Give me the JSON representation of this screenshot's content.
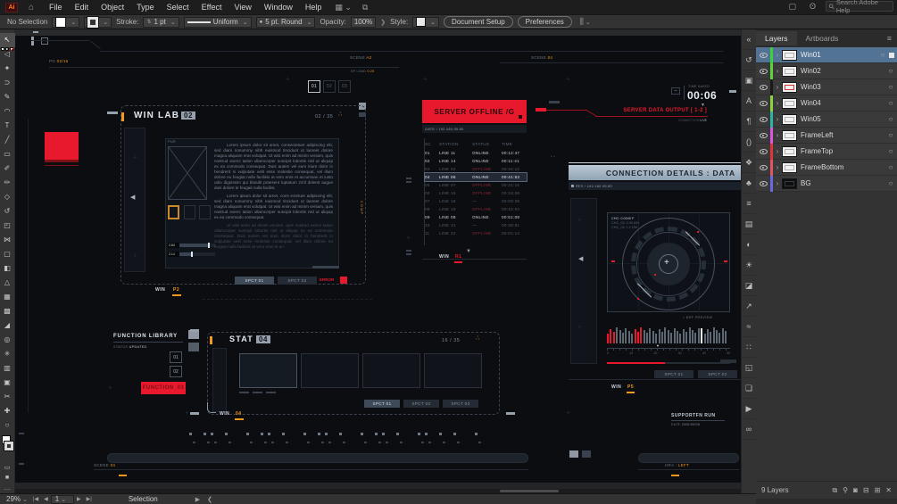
{
  "app": {
    "menubar": {
      "logo": "Ai",
      "menus": [
        "File",
        "Edit",
        "Object",
        "Type",
        "Select",
        "Effect",
        "View",
        "Window",
        "Help"
      ],
      "search_placeholder": "Search Adobe Help"
    },
    "controlbar": {
      "no_selection": "No Selection",
      "stroke_label": "Stroke:",
      "stroke_value": "1 pt",
      "variable_width": "Uniform",
      "brush": "5 pt. Round",
      "opacity_label": "Opacity:",
      "opacity_value": "100%",
      "style_label": "Style:",
      "document_setup": "Document Setup",
      "preferences": "Preferences"
    },
    "tools": [
      {
        "name": "selection-tool",
        "glyph": "↖",
        "active": true
      },
      {
        "name": "direct-selection-tool",
        "glyph": "◁"
      },
      {
        "name": "magic-wand-tool",
        "glyph": "✦"
      },
      {
        "name": "lasso-tool",
        "glyph": "⊃"
      },
      {
        "name": "pen-tool",
        "glyph": "✎"
      },
      {
        "name": "curvature-tool",
        "glyph": "◠"
      },
      {
        "name": "type-tool",
        "glyph": "T"
      },
      {
        "name": "line-tool",
        "glyph": "╱"
      },
      {
        "name": "rectangle-tool",
        "glyph": "▭"
      },
      {
        "name": "paintbrush-tool",
        "glyph": "✐"
      },
      {
        "name": "pencil-tool",
        "glyph": "✏"
      },
      {
        "name": "eraser-tool",
        "glyph": "◇"
      },
      {
        "name": "rotate-tool",
        "glyph": "↺"
      },
      {
        "name": "scale-tool",
        "glyph": "◰"
      },
      {
        "name": "width-tool",
        "glyph": "⋈"
      },
      {
        "name": "free-transform-tool",
        "glyph": "▢"
      },
      {
        "name": "shape-builder-tool",
        "glyph": "◧"
      },
      {
        "name": "perspective-grid-tool",
        "glyph": "△"
      },
      {
        "name": "mesh-tool",
        "glyph": "▦"
      },
      {
        "name": "gradient-tool",
        "glyph": "▩"
      },
      {
        "name": "eyedropper-tool",
        "glyph": "◢"
      },
      {
        "name": "blend-tool",
        "glyph": "◎"
      },
      {
        "name": "symbol-sprayer-tool",
        "glyph": "✳"
      },
      {
        "name": "column-graph-tool",
        "glyph": "▥"
      },
      {
        "name": "artboard-tool",
        "glyph": "▣"
      },
      {
        "name": "slice-tool",
        "glyph": "✂"
      },
      {
        "name": "hand-tool",
        "glyph": "✚"
      },
      {
        "name": "zoom-tool",
        "glyph": "○"
      }
    ],
    "dock_icons": [
      {
        "name": "collapse-panels-icon",
        "glyph": "«"
      },
      {
        "name": "rotate-view-icon",
        "glyph": "↺"
      },
      {
        "name": "artboards-panel-icon",
        "glyph": "▣"
      },
      {
        "name": "character-panel-icon",
        "glyph": "A"
      },
      {
        "name": "paragraph-panel-icon",
        "glyph": "¶"
      },
      {
        "name": "glyphs-panel-icon",
        "glyph": "()"
      },
      {
        "name": "image-trace-panel-icon",
        "glyph": "❖"
      },
      {
        "name": "symbols-panel-icon",
        "glyph": "♣"
      },
      {
        "name": "stroke-panel-icon",
        "glyph": "≡"
      },
      {
        "name": "appearance-panel-icon",
        "glyph": "▤"
      },
      {
        "name": "color-panel-icon",
        "glyph": "◐"
      },
      {
        "name": "gradient-panel-icon",
        "glyph": "☀"
      },
      {
        "name": "transparency-panel-icon",
        "glyph": "◪"
      },
      {
        "name": "export-panel-icon",
        "glyph": "↗"
      },
      {
        "name": "properties-panel-icon",
        "glyph": "≈"
      },
      {
        "name": "align-panel-icon",
        "glyph": "∷"
      },
      {
        "name": "pathfinder-panel-icon",
        "glyph": "◱"
      },
      {
        "name": "libraries-panel-icon",
        "glyph": "❏"
      },
      {
        "name": "actions-panel-icon",
        "glyph": "▶"
      },
      {
        "name": "links-panel-icon",
        "glyph": "∞"
      }
    ],
    "layers_panel": {
      "tabs": [
        "Layers",
        "Artboards"
      ],
      "rows": [
        {
          "name": "Win01",
          "color": "#3ad33a",
          "selected": true,
          "thumb": "t-std"
        },
        {
          "name": "Win02",
          "color": "#5bd33a",
          "thumb": "t-std"
        },
        {
          "name": "Win03",
          "color": "#1a1a1a",
          "thumb": "t-red"
        },
        {
          "name": "Win04",
          "color": "#8cd33a",
          "thumb": "t-std"
        },
        {
          "name": "Win05",
          "color": "#2ab5a5",
          "thumb": "t-std"
        },
        {
          "name": "FrameLeft",
          "color": "#e055e0",
          "thumb": "t-std"
        },
        {
          "name": "FrameTop",
          "color": "#e03535",
          "thumb": "t-std"
        },
        {
          "name": "FrameBottom",
          "color": "#e05560",
          "thumb": "t-std"
        },
        {
          "name": "BG",
          "color": "#6a6ae0",
          "thumb": "t-dark"
        }
      ],
      "status": "9 Layers",
      "footer_icons": [
        {
          "name": "collect-for-export-icon",
          "glyph": "⧉"
        },
        {
          "name": "locate-object-icon",
          "glyph": "⚲"
        },
        {
          "name": "make-mask-icon",
          "glyph": "◙"
        },
        {
          "name": "new-sublayer-icon",
          "glyph": "⊟"
        },
        {
          "name": "new-layer-icon",
          "glyph": "⊞"
        },
        {
          "name": "delete-layer-icon",
          "glyph": "✕"
        }
      ]
    },
    "statusbar": {
      "zoom": "29%",
      "artboard": "1",
      "tool": "Selection"
    }
  },
  "canvas": {
    "top": {
      "pg_label": "PG",
      "pg_value": "02/16",
      "scene1_label": "SCENE",
      "scene1_value": "A2",
      "scene1_sub_label": "SP LOAD",
      "scene1_sub_value": "0:25",
      "scene2_label": "SCENE",
      "scene2_value": "04",
      "time_label": "TIME SAVED",
      "time_value": "00:06"
    },
    "tabs": [
      "01",
      "02",
      "03"
    ],
    "winlab": {
      "title": "WIN LAB",
      "badge": "02",
      "counter": "02 / 35",
      "corner_dots": "∴",
      "pnr": "PNR",
      "sliders": [
        {
          "label": "2.84"
        },
        {
          "label": "2.14"
        }
      ],
      "p1": "Lorem ipsum dolor sit amet, consectetuer adipiscing elit, sed diam nonummy nibh euismod tincidunt ut laoreet dolore magna aliquam erat volutpat. Ut wisi enim ad minim veniam, quis nostrud exerci tation ullamcorper suscipit lobortis nisl ut aliquip ex ea commodo consequat. Duis autem vel eum iriure dolor in hendrerit in vulputate velit esse molestie consequat, vel illum dolore eu feugiat nulla facilisis at vero eros et accumsan et iusto odio dignissim qui blandit praesent luptatum zzril delenit augue duis dolore te feugait nulla facilisi.",
      "p2": "Lorem ipsum dolor sit amet, cons ectetuer adipiscing elit, sed diam nonummy nibh euismod tincidunt ut laoreet dolore magna aliquam erat volutpat. Ut wisi enim ad minim veniam, quis nostrud exerci tation ullamcorper suscipit lobortis nisl ut aliquip ex ea commodo consequat.",
      "p3": "Ut wisi enim ad minim veniam, quis nostrud exerci tation ullamcorper suscipit lobortis nisl ut aliquip ex ea commodo consequat. Duis autem vel eum iriure dolor in hendrerit in vulputate velit esse molestie consequat, vel illum dolore eu feugiat nulla facilisis at vero eros et ac-",
      "buttons": [
        "SPCT 01",
        "SPCT 02"
      ],
      "error_label": "ERROR",
      "footer_win": "WIN",
      "footer_tag": "P2",
      "side_text": "COMP"
    },
    "server": {
      "title": "SERVER OFFLINE /G",
      "gate": "GATE / 192.160.95.80",
      "columns": [
        "SC",
        "STATION",
        "STATUS",
        "TIME"
      ],
      "rows": [
        {
          "sc": "01",
          "station": "LINE 11",
          "status": "ONLINE",
          "time": "00:12:47",
          "dim": false,
          "hl": false
        },
        {
          "sc": "02",
          "station": "LINE 14",
          "status": "ONLINE",
          "time": "00:11:41",
          "dim": false,
          "hl": false
        },
        {
          "sc": "03",
          "station": "LINE 02",
          "status": "OFFLINE",
          "time": "00:34:12",
          "dim": true,
          "hl": false
        },
        {
          "sc": "04",
          "station": "LINE 06",
          "status": "ONLINE",
          "time": "00:41:53",
          "dim": false,
          "hl": true
        },
        {
          "sc": "05",
          "station": "LINE 07",
          "status": "OFFLINE",
          "time": "00:31:15",
          "dim": true,
          "hl": false
        },
        {
          "sc": "06",
          "station": "LINE 16",
          "status": "OFFLINE",
          "time": "00:18:08",
          "dim": true,
          "hl": false
        },
        {
          "sc": "07",
          "station": "LINE 18",
          "status": "—",
          "time": "00:09:38",
          "dim": true,
          "hl": false
        },
        {
          "sc": "08",
          "station": "LINE 19",
          "status": "OFFLINE",
          "time": "00:15:04",
          "dim": true,
          "hl": false
        },
        {
          "sc": "09",
          "station": "LINE 09",
          "status": "ONLINE",
          "time": "00:51:08",
          "dim": false,
          "hl": false
        },
        {
          "sc": "10",
          "station": "LINE 31",
          "status": "—",
          "time": "00:48:51",
          "dim": true,
          "hl": false
        },
        {
          "sc": "11",
          "station": "LINE 22",
          "status": "OFFLINE",
          "time": "00:01:14",
          "dim": true,
          "hl": false
        }
      ],
      "footer_win": "WIN",
      "footer_tag": "R1"
    },
    "server_output": {
      "label": "SERVER DATA OUTPUT [ 1-2 ]",
      "sub_label": "CONNECTION",
      "sub_value": "LIVE"
    },
    "connection": {
      "title": "CONNECTION DETAILS : DATA",
      "res": "RES / 192.160.95.80",
      "radar_labels": [
        {
          "k": "CHC:",
          "v": "0.0040 F",
          "bright": true
        },
        {
          "k": "CHC_02:",
          "v": "0.00 AM",
          "bright": false
        },
        {
          "k": "CHC_04:",
          "v": "1.1 DM",
          "bright": false
        }
      ],
      "preview": "< BRF PREVIEW",
      "eq_pattern": "rrrggggggrrrgggggggggggggggggggwgggggggg",
      "ruler": [
        "0",
        "10",
        "20",
        "30",
        "40",
        "50"
      ],
      "buttons": [
        "SPCT 01",
        "SPCT 02"
      ],
      "footer_win": "WIN",
      "footer_tag": "P5"
    },
    "funclib": {
      "title": "FUNCTION LIBRARY",
      "status_label": "STATUS",
      "status_value": "UPDATED",
      "buttons": [
        "01",
        "02"
      ],
      "action": "FUNCTION_03"
    },
    "stat": {
      "title": "STAT",
      "badge": "04",
      "counter": "16 / 35",
      "corner_dots": "∴",
      "buttons": [
        "SPCT 01",
        "SPCT 02",
        "SPCT 03"
      ],
      "footer_win": "WIN",
      "footer_tag": "04"
    },
    "support": {
      "title": "SUPPORTFN RUN",
      "sub_label": "DATE",
      "sub_value": "2000/09/05"
    },
    "bottom": {
      "scene_label": "SCENE",
      "scene_value": "04",
      "hra_label": "HRA :",
      "hra_value": "LEFT"
    },
    "tick_pattern": "101101001011010010110100101101001101010010"
  }
}
